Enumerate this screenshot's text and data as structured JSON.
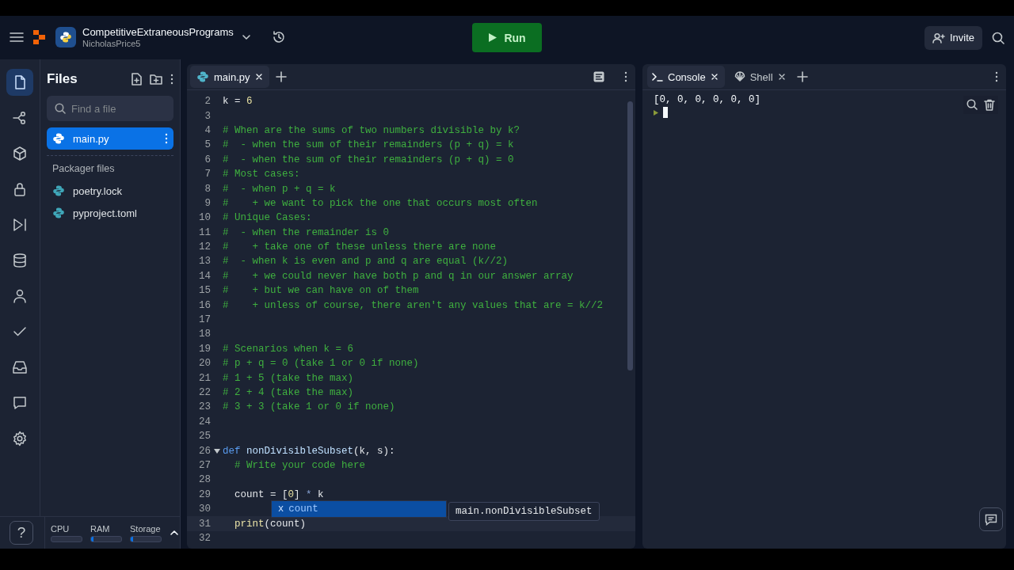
{
  "header": {
    "project_name": "CompetitiveExtraneousPrograms",
    "owner": "NicholasPrice5",
    "run_label": "Run",
    "invite_label": "Invite"
  },
  "rail": [
    {
      "kind": "files",
      "selected": true
    },
    {
      "kind": "git",
      "selected": false
    },
    {
      "kind": "packages",
      "selected": false
    },
    {
      "kind": "secrets",
      "selected": false
    },
    {
      "kind": "workflows",
      "selected": false
    },
    {
      "kind": "database",
      "selected": false
    },
    {
      "kind": "user",
      "selected": false
    },
    {
      "kind": "check",
      "selected": false
    },
    {
      "kind": "inbox",
      "selected": false
    },
    {
      "kind": "chat",
      "selected": false
    },
    {
      "kind": "settings",
      "selected": false
    }
  ],
  "help_label": "?",
  "files": {
    "title": "Files",
    "search": {
      "placeholder": "Find a file"
    },
    "items": [
      {
        "name": "main.py",
        "selected": true
      }
    ],
    "section_title": "Packager files",
    "packager_items": [
      {
        "name": "poetry.lock",
        "selected": false
      },
      {
        "name": "pyproject.toml",
        "selected": false
      }
    ]
  },
  "resources": [
    {
      "label": "CPU"
    },
    {
      "label": "RAM",
      "level": 0.08
    },
    {
      "label": "Storage",
      "level": 0.08
    }
  ],
  "editor": {
    "tabs": [
      {
        "label": "main.py",
        "selected": true
      }
    ],
    "lines": [
      {
        "num": "2",
        "parts": [
          {
            "kind": "plain",
            "text": "k = "
          },
          {
            "kind": "number",
            "text": "6"
          }
        ]
      },
      {
        "num": "3"
      },
      {
        "num": "4",
        "parts": [
          {
            "kind": "comment",
            "text": "# When are the sums of two numbers divisible by k?"
          }
        ]
      },
      {
        "num": "5",
        "parts": [
          {
            "kind": "comment",
            "text": "#  - when the sum of their remainders (p + q) = k"
          }
        ]
      },
      {
        "num": "6",
        "parts": [
          {
            "kind": "comment",
            "text": "#  - when the sum of their remainders (p + q) = 0"
          }
        ]
      },
      {
        "num": "7",
        "parts": [
          {
            "kind": "comment",
            "text": "# Most cases:"
          }
        ]
      },
      {
        "num": "8",
        "parts": [
          {
            "kind": "comment",
            "text": "#  - when p + q = k"
          }
        ]
      },
      {
        "num": "9",
        "parts": [
          {
            "kind": "comment",
            "text": "#    + we want to pick the one that occurs most often"
          }
        ]
      },
      {
        "num": "10",
        "parts": [
          {
            "kind": "comment",
            "text": "# Unique Cases:"
          }
        ]
      },
      {
        "num": "11",
        "parts": [
          {
            "kind": "comment",
            "text": "#  - when the remainder is 0"
          }
        ]
      },
      {
        "num": "12",
        "parts": [
          {
            "kind": "comment",
            "text": "#    + take one of these unless there are none"
          }
        ]
      },
      {
        "num": "13",
        "parts": [
          {
            "kind": "comment",
            "text": "#  - when k is even and p and q are equal (k//2)"
          }
        ]
      },
      {
        "num": "14",
        "parts": [
          {
            "kind": "comment",
            "text": "#    + we could never have both p and q in our answer array"
          }
        ]
      },
      {
        "num": "15",
        "parts": [
          {
            "kind": "comment",
            "text": "#    + but we can have on of them"
          }
        ]
      },
      {
        "num": "16",
        "parts": [
          {
            "kind": "comment",
            "text": "#    + unless of course, there aren't any values that are = k//2"
          }
        ]
      },
      {
        "num": "17"
      },
      {
        "num": "18"
      },
      {
        "num": "19",
        "parts": [
          {
            "kind": "comment",
            "text": "# Scenarios when k = 6"
          }
        ]
      },
      {
        "num": "20",
        "parts": [
          {
            "kind": "comment",
            "text": "# p + q = 0 (take 1 or 0 if none)"
          }
        ]
      },
      {
        "num": "21",
        "parts": [
          {
            "kind": "comment",
            "text": "# 1 + 5 (take the max)"
          }
        ]
      },
      {
        "num": "22",
        "parts": [
          {
            "kind": "comment",
            "text": "# 2 + 4 (take the max)"
          }
        ]
      },
      {
        "num": "23",
        "parts": [
          {
            "kind": "comment",
            "text": "# 3 + 3 (take 1 or 0 if none)"
          }
        ]
      },
      {
        "num": "24"
      },
      {
        "num": "25"
      },
      {
        "num": "26",
        "expanded": true,
        "parts": [
          {
            "kind": "keyword",
            "text": "def "
          },
          {
            "kind": "func",
            "text": "nonDivisibleSubset"
          },
          {
            "kind": "plain",
            "text": "(k, s):"
          }
        ]
      },
      {
        "num": "27",
        "parts": [
          {
            "kind": "comment",
            "text": "  # Write your code here"
          }
        ]
      },
      {
        "num": "28"
      },
      {
        "num": "29",
        "parts": [
          {
            "kind": "plain",
            "text": "  count = ["
          },
          {
            "kind": "number",
            "text": "0"
          },
          {
            "kind": "plain",
            "text": "] "
          },
          {
            "kind": "operator",
            "text": "*"
          },
          {
            "kind": "plain",
            "text": " k"
          }
        ]
      },
      {
        "num": "30"
      },
      {
        "num": "31",
        "current": true,
        "parts": [
          {
            "kind": "builtin",
            "text": "  print"
          },
          {
            "kind": "plain",
            "text": "(count)"
          }
        ]
      },
      {
        "num": "32"
      }
    ],
    "autocomplete": {
      "items": [
        {
          "icon": "x",
          "label": "count",
          "selected": true
        }
      ],
      "detail": "main.nonDivisibleSubset"
    }
  },
  "console": {
    "tabs": [
      {
        "kind": "console",
        "label": "Console",
        "selected": true
      },
      {
        "kind": "shell",
        "label": "Shell",
        "selected": false
      }
    ],
    "output": [
      "[0, 0, 0, 0, 0, 0]"
    ]
  }
}
